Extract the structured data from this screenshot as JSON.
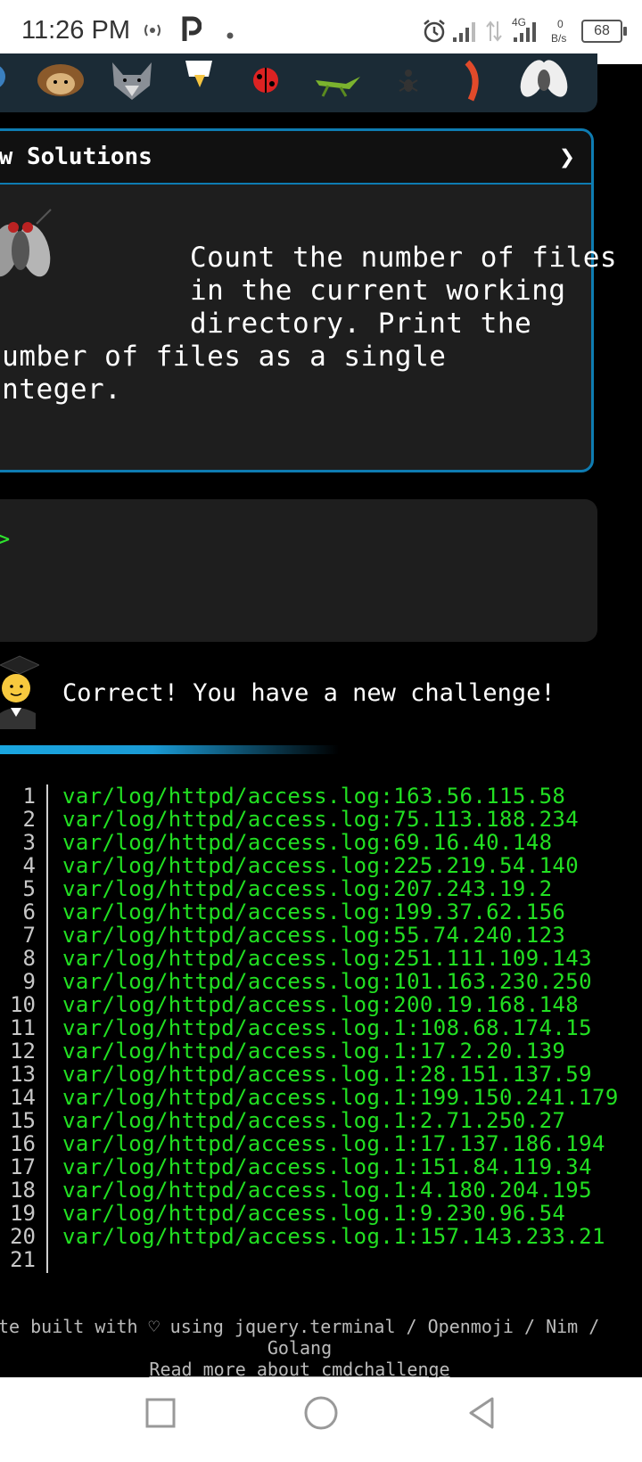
{
  "status_bar": {
    "time": "11:26 PM",
    "network_type": "4G",
    "speed_value": "0",
    "speed_unit": "B/s",
    "battery": "68"
  },
  "animals": [
    "owl-icon",
    "hedgehog-icon",
    "wolf-icon",
    "eagle-icon",
    "ladybug-icon",
    "grasshopper-icon",
    "ant-icon",
    "shrimp-icon",
    "fly-icon"
  ],
  "challenge": {
    "title": "ew Solutions",
    "chevron": "❯",
    "text": "            Count the number of files\n            in the current working\n            directory. Print the\nnumber of files as a single\ninteger."
  },
  "terminal": {
    "prompt": ")>"
  },
  "feedback": {
    "message": "Correct! You have a new challenge!"
  },
  "output": {
    "lines": [
      {
        "n": "1",
        "text": "var/log/httpd/access.log:163.56.115.58"
      },
      {
        "n": "2",
        "text": "var/log/httpd/access.log:75.113.188.234"
      },
      {
        "n": "3",
        "text": "var/log/httpd/access.log:69.16.40.148"
      },
      {
        "n": "4",
        "text": "var/log/httpd/access.log:225.219.54.140"
      },
      {
        "n": "5",
        "text": "var/log/httpd/access.log:207.243.19.2"
      },
      {
        "n": "6",
        "text": "var/log/httpd/access.log:199.37.62.156"
      },
      {
        "n": "7",
        "text": "var/log/httpd/access.log:55.74.240.123"
      },
      {
        "n": "8",
        "text": "var/log/httpd/access.log:251.111.109.143"
      },
      {
        "n": "9",
        "text": "var/log/httpd/access.log:101.163.230.250"
      },
      {
        "n": "10",
        "text": "var/log/httpd/access.log:200.19.168.148"
      },
      {
        "n": "11",
        "text": "var/log/httpd/access.log.1:108.68.174.15"
      },
      {
        "n": "12",
        "text": "var/log/httpd/access.log.1:17.2.20.139"
      },
      {
        "n": "13",
        "text": "var/log/httpd/access.log.1:28.151.137.59"
      },
      {
        "n": "14",
        "text": "var/log/httpd/access.log.1:199.150.241.179"
      },
      {
        "n": "15",
        "text": "var/log/httpd/access.log.1:2.71.250.27"
      },
      {
        "n": "16",
        "text": "var/log/httpd/access.log.1:17.137.186.194"
      },
      {
        "n": "17",
        "text": "var/log/httpd/access.log.1:151.84.119.34"
      },
      {
        "n": "18",
        "text": "var/log/httpd/access.log.1:4.180.204.195"
      },
      {
        "n": "19",
        "text": "var/log/httpd/access.log.1:9.230.96.54"
      },
      {
        "n": "20",
        "text": "var/log/httpd/access.log.1:157.143.233.21"
      },
      {
        "n": "21",
        "text": ""
      }
    ]
  },
  "footer": {
    "line1": "te built with ♡ using jquery.terminal / Openmoji / Nim /",
    "line2": "Golang",
    "line3": "Read more about cmdchallenge"
  },
  "colors": {
    "accent": "#0e7cb2",
    "terminal_green": "#22e022"
  }
}
